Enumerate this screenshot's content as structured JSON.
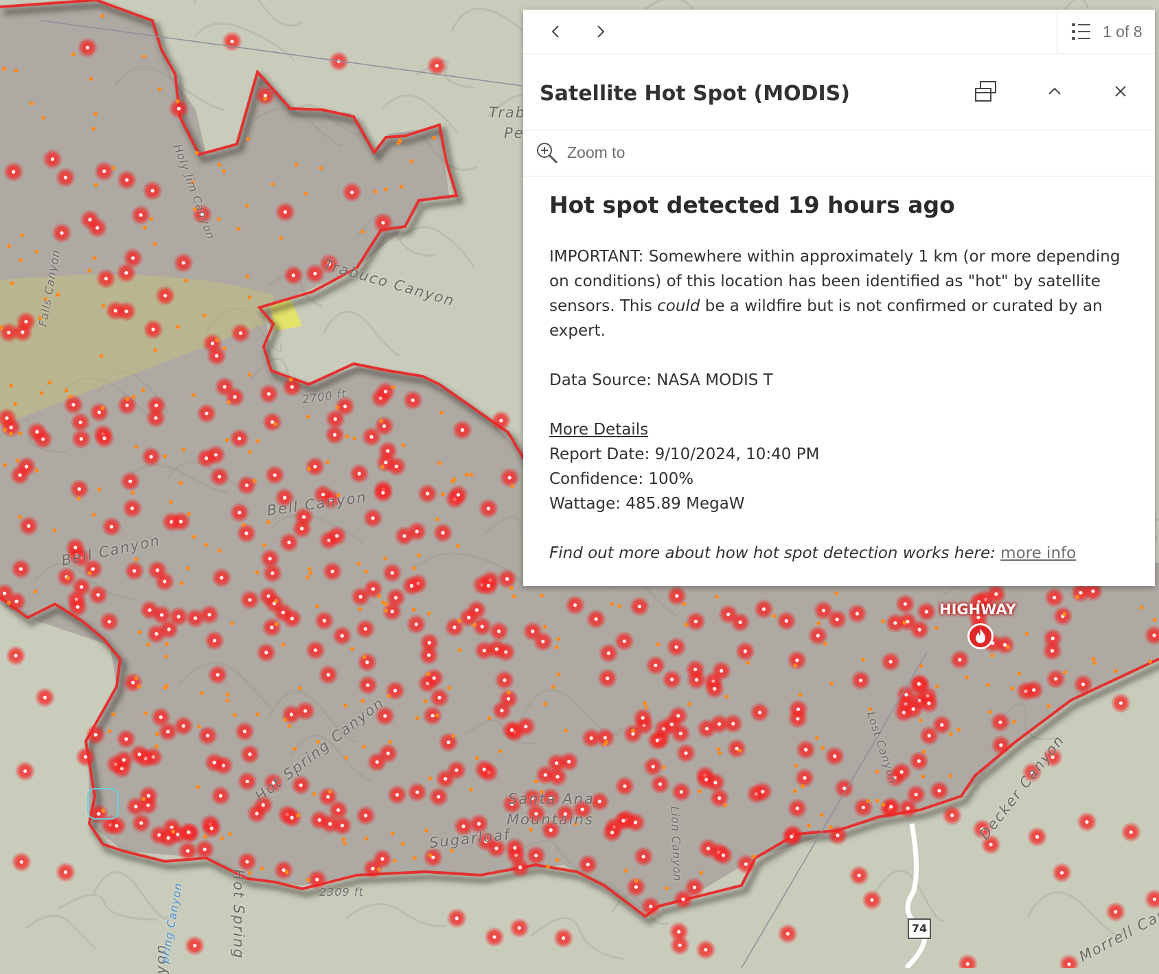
{
  "map": {
    "place_labels": [
      {
        "text": "Trabuco Canyon"
      },
      {
        "text": "Bell Canyon"
      },
      {
        "text": "Bell Canyon"
      },
      {
        "text": "Holy Jim Canyon"
      },
      {
        "text": "Falls Canyon"
      },
      {
        "text": "Hot Spring Canyon"
      },
      {
        "text": "Santa Ana"
      },
      {
        "text": "Mountains"
      },
      {
        "text": "Sugarloaf"
      },
      {
        "text": "Decker Canyon"
      },
      {
        "text": "Lion Canyon"
      },
      {
        "text": "Lost Canyon"
      },
      {
        "text": "Morrell Can"
      },
      {
        "text": "Trab"
      },
      {
        "text": "Pe"
      },
      {
        "text": "Hot Spring"
      },
      {
        "text": "yon"
      },
      {
        "text": "pring Canyon"
      }
    ],
    "elevations": [
      "2309 ft",
      "2700 ft"
    ],
    "fire_name": "HIGHWAY",
    "route_shield": "74",
    "colors": {
      "terrain": "#c9ccbb",
      "burn_area": "#8f7f84",
      "perimeter": "#e4302f",
      "hotspot": "#ff2a2a"
    }
  },
  "popup": {
    "nav": {
      "prev_icon": "chevron-left-icon",
      "next_icon": "chevron-right-icon",
      "count": "1 of 8"
    },
    "title": "Satellite Hot Spot (MODIS)",
    "zoom_label": "Zoom to",
    "heading": "Hot spot detected 19 hours ago",
    "important_prefix": "IMPORTANT: Somewhere within approximately 1 km (or more depending on conditions) of this location has been identified as \"hot\" by satellite sensors. This ",
    "important_em": "could",
    "important_suffix": " be a wildfire but is not confirmed or curated by an expert.",
    "data_source": "Data Source: NASA MODIS T",
    "more_details": "More Details",
    "report_date": "Report Date: 9/10/2024, 10:40 PM",
    "confidence": "Confidence: 100%",
    "wattage": "Wattage: 485.89 MegaW",
    "find_out": "Find out more about how hot spot detection works here:",
    "more_info": "more info"
  }
}
